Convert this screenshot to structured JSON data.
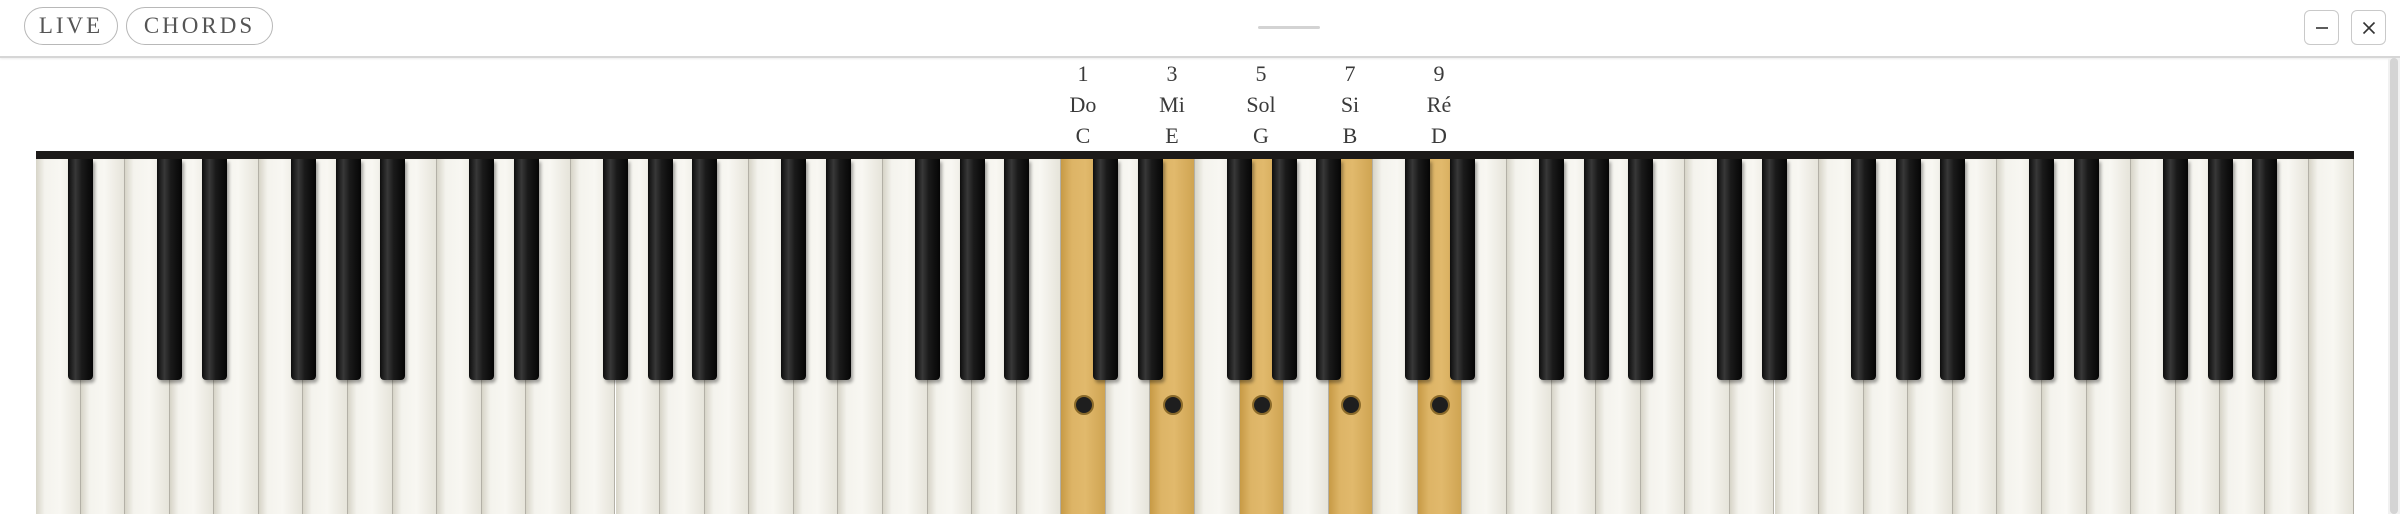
{
  "toolbar": {
    "live_label": "LIVE",
    "chords_label": "CHORDS"
  },
  "window": {
    "minimize_icon": "minus-icon",
    "close_icon": "x-icon"
  },
  "chord_notes": [
    {
      "degree": "1",
      "solfege": "Do",
      "letter": "C"
    },
    {
      "degree": "3",
      "solfege": "Mi",
      "letter": "E"
    },
    {
      "degree": "5",
      "solfege": "Sol",
      "letter": "G"
    },
    {
      "degree": "7",
      "solfege": "Si",
      "letter": "B"
    },
    {
      "degree": "9",
      "solfege": "Ré",
      "letter": "D"
    }
  ],
  "keyboard": {
    "white_key_count": 52,
    "highlight_color": "#ddb466",
    "highlighted_white_keys": [
      23,
      25,
      27,
      29,
      31
    ]
  }
}
